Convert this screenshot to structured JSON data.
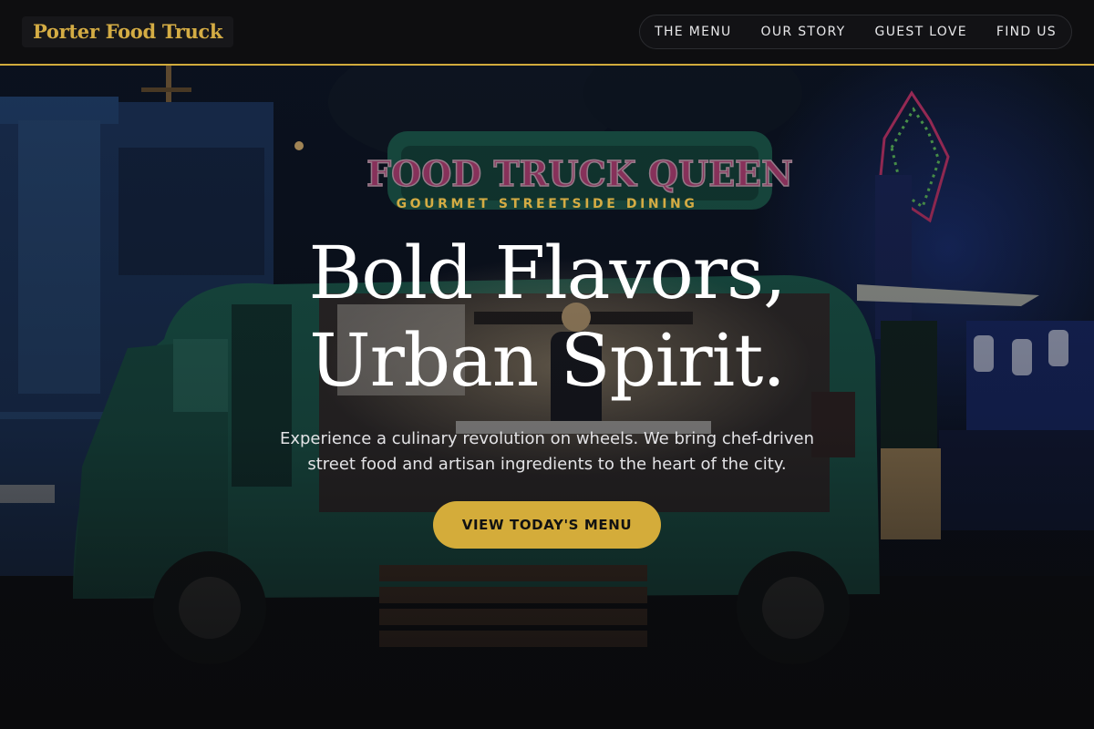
{
  "brand": {
    "name": "Porter Food Truck"
  },
  "nav": {
    "links": [
      {
        "label": "THE MENU"
      },
      {
        "label": "OUR STORY"
      },
      {
        "label": "GUEST LOVE"
      },
      {
        "label": "FIND US"
      }
    ]
  },
  "hero": {
    "image_sign_text": "FOOD TRUCK QUEEN",
    "eyebrow": "GOURMET STREETSIDE DINING",
    "headline_line1": "Bold Flavors,",
    "headline_line2": "Urban Spirit.",
    "subtitle": "Experience a culinary revolution on wheels. We bring chef-driven street food and artisan ingredients to the heart of the city.",
    "cta_label": "VIEW TODAY'S MENU"
  },
  "colors": {
    "accent": "#d4ac3a",
    "header_bg": "#0e0e10",
    "truck_green": "#1f6b58"
  }
}
